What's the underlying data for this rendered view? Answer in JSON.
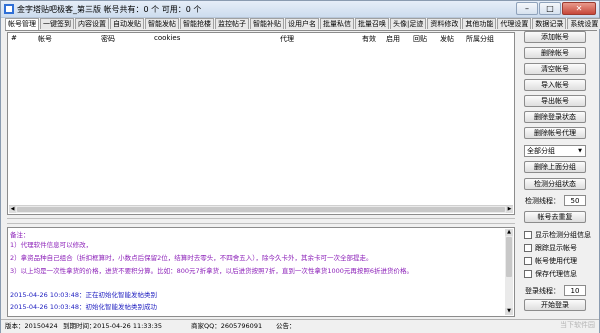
{
  "window": {
    "title": "金字塔贴吧极客_第三版 帐号共有：0 个 可用：0 个"
  },
  "tabs": [
    "帐号管理",
    "一键签到",
    "内容设置",
    "自动发贴",
    "智能发帖",
    "智能抢楼",
    "监控帖子",
    "智能补贴",
    "设用户名",
    "批量私信",
    "批量召唤",
    "头像|足迹",
    "资料修改",
    "其他功能",
    "代理设置",
    "数据记录",
    "系统设置"
  ],
  "table": {
    "columns": [
      "#",
      "帐号",
      "密码",
      "cookies",
      "代理",
      "有效",
      "启用",
      "回贴",
      "发帖",
      "所属分组"
    ]
  },
  "buttons": {
    "add": "添加帐号",
    "delete": "删除帐号",
    "clear": "清空帐号",
    "import": "导入帐号",
    "export": "导出帐号",
    "delete_login": "删除登录状态",
    "delete_proxy": "删除帐号代理",
    "delete_group": "删除上面分组",
    "check_group": "检测分组状态",
    "reset_account": "帐号去重复",
    "start_login": "开始登录"
  },
  "group_select": {
    "value": "全部分组"
  },
  "threads": {
    "check_label": "检测线程：",
    "check_value": "50",
    "login_label": "登录线程：",
    "login_value": "10"
  },
  "checkboxes": [
    "显示检测分组信息",
    "跟踪显示帐号",
    "帐号使用代理",
    "保存代理信息"
  ],
  "log": {
    "lines": [
      "备注：",
      "1）代理软件信息可以修改，",
      "2）拿资品种自己组合（折扣框算时，小数点后保留2位，结算时去零头，不四舍五入），除今久卡外，其余卡可一次全部提走。",
      "3）以上均是一次性拿货的价格，进货不要积分算。比如：800元7折拿货，以后进货按照7折，直到一次性拿货1000元再按照6折进货价格。",
      "2015-04-26 10:03:48：正在初始化智能发帖类别",
      "2015-04-26 10:03:48：初始化智能发帖类别成功"
    ]
  },
  "status": {
    "version": "版本：20150424",
    "expire_label": "到期时间：",
    "expire_value": "2015-04-26 11:33:35",
    "qq": "商家QQ：2605796091",
    "notice": "公告："
  },
  "watermark": "当下软件园"
}
